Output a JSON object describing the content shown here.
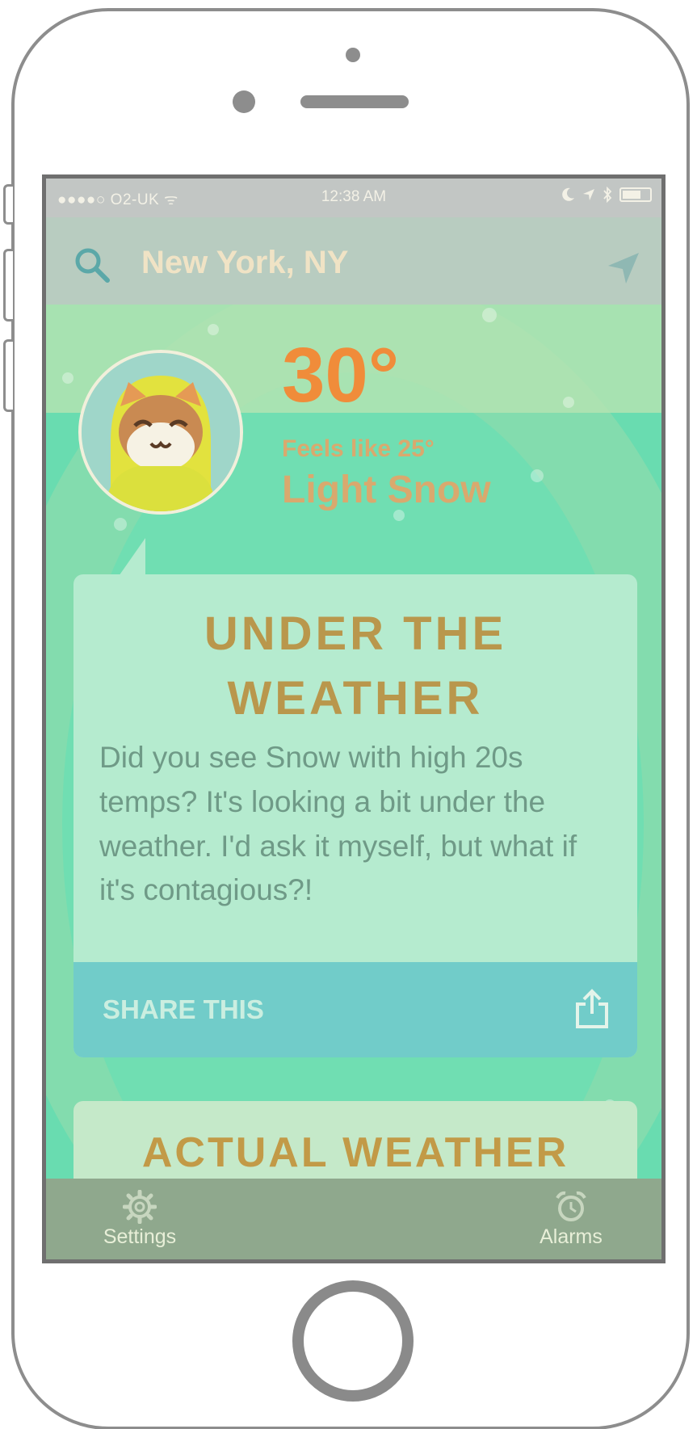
{
  "status_bar": {
    "carrier": "●●●●○ O2-UK ᯤ",
    "time": "12:38 AM"
  },
  "header": {
    "location": "New York, NY",
    "search_icon": "search-icon",
    "locate_icon": "location-arrow-icon"
  },
  "weather": {
    "temperature": "30°",
    "feels_like": "Feels like 25°",
    "condition": "Light Snow"
  },
  "card": {
    "title_line1": "UNDER THE",
    "title_line2": "WEATHER",
    "body": "Did you see Snow with high 20s temps? It's looking a bit under the weather. I'd ask it myself, but what if it's contagious?!",
    "share_label": "SHARE THIS"
  },
  "card2": {
    "title": "ACTUAL WEATHER"
  },
  "tabs": {
    "settings_label": "Settings",
    "alarms_label": "Alarms"
  },
  "colors": {
    "accent_orange": "#f08c3a",
    "card_title": "#b9974c",
    "share_bar": "#71ccc9",
    "background_green": "#69dcb0"
  }
}
